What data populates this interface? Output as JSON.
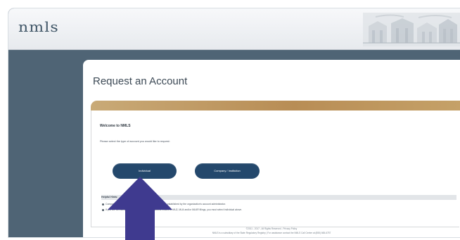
{
  "header": {
    "logo_text": "nmls"
  },
  "page": {
    "title": "Request an Account"
  },
  "panel": {
    "welcome": "Welcome to NMLS",
    "instruction": "Please select the type of account you would like to request:",
    "buttons": {
      "individual": "Individual",
      "company": "Company / Institution"
    },
    "hints": {
      "title": "Helpful Hints:",
      "items": [
        "Company / Institution: regulator/agency user accounts are established by the organization's account administrator.",
        "If you are an individual who needs to perform actions related to MU2, MU4 and/or MU4R filings, you must select Individual above."
      ]
    }
  },
  "footer": {
    "line1": "©2011 - 2017 - All Rights Reserved - Privacy Policy",
    "line2": "NMLS is a subsidiary of the State Regulatory Registry | For assistance contact the NMLS Call Center at (855) 665-6757"
  },
  "colors": {
    "frame": "#4f6475",
    "button": "#24486c",
    "panel_header": "#b88d55",
    "arrow": "#3f3a8f"
  },
  "icons": {
    "building": "building-icon",
    "arrow": "up-arrow-icon"
  }
}
